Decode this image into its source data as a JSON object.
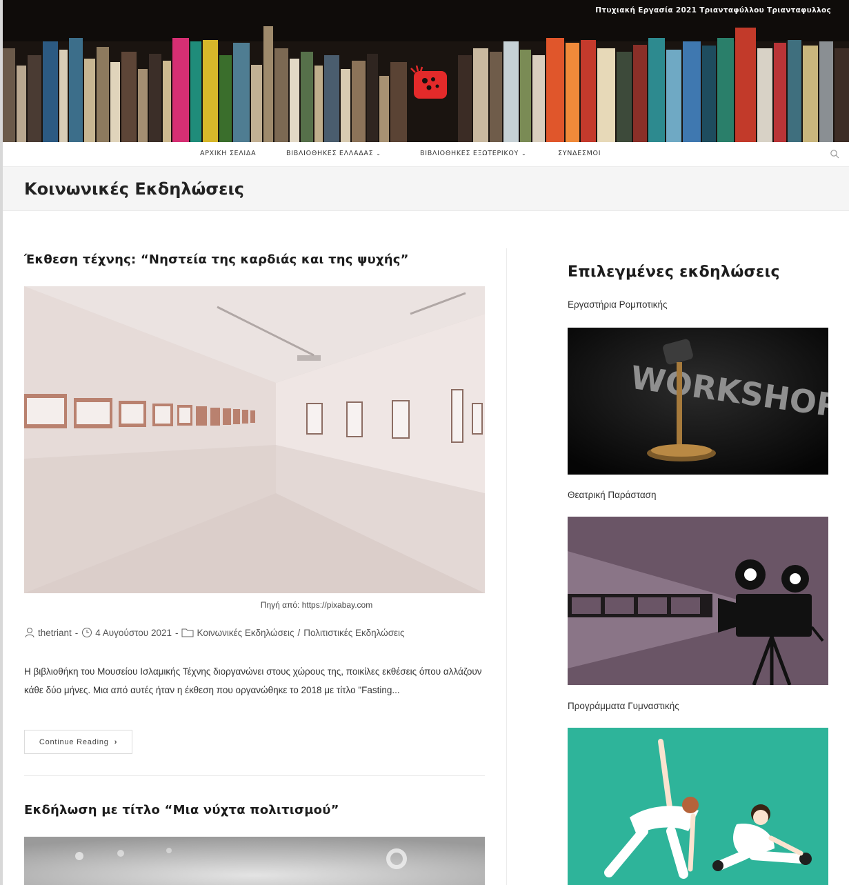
{
  "header": {
    "caption": "Πτυχιακή Εργασία 2021 Τριανταφύλλου Τριανταφυλλος"
  },
  "nav": {
    "items": [
      {
        "label": "ΑΡΧΙΚΗ ΣΕΛΙΔΑ",
        "dropdown": false
      },
      {
        "label": "ΒΙΒΛΙΟΘΗΚΕΣ ΕΛΛΑΔΑΣ",
        "dropdown": true
      },
      {
        "label": "ΒΙΒΛΙΟΘΗΚΕΣ ΕΞΩΤΕΡΙΚΟΥ",
        "dropdown": true
      },
      {
        "label": "ΣΥΝΔΕΣΜΟΙ",
        "dropdown": false
      }
    ],
    "search_icon": "search-icon"
  },
  "page": {
    "title": "Κοινωνικές Εκδηλώσεις"
  },
  "posts": [
    {
      "title": "Έκθεση τέχνης: “Νηστεία της καρδιάς και της ψυχής”",
      "image_caption": "Πηγή από: https://pixabay.com",
      "author": "thetriant",
      "date": "4 Αυγούστου 2021",
      "category_1": "Κοινωνικές Εκδηλώσεις",
      "category_sep": "/",
      "category_2": "Πολιτιστικές Εκδηλώσεις",
      "excerpt": "Η βιβλιοθήκη του Μουσείου Ισλαμικής Τέχνης διοργανώνει στους χώρους της, ποικίλες εκθέσεις όπου αλλάζουν κάθε δύο μήνες. Μια από αυτές ήταν η έκθεση που οργανώθηκε το 2018 με τίτλο \"Fasting...",
      "read_more": "Continue Reading"
    },
    {
      "title": "Εκδήλωση με τίτλο “Μια νύχτα πολιτισμού”"
    }
  ],
  "sidebar": {
    "widget_title": "Επιλεγμένες εκδηλώσεις",
    "items": [
      {
        "label": "Εργαστήρια Ρομποτικής",
        "image_text": "WORKSHOP"
      },
      {
        "label": "Θεατρική Παράσταση"
      },
      {
        "label": "Προγράμματα Γυμναστικής"
      }
    ]
  },
  "colors": {
    "accent": "#13aff0",
    "banner_bg": "#15110e",
    "film_bg": "#6a5566",
    "fitness_bg": "#2eb49a",
    "logo_red": "#e32a2a"
  }
}
